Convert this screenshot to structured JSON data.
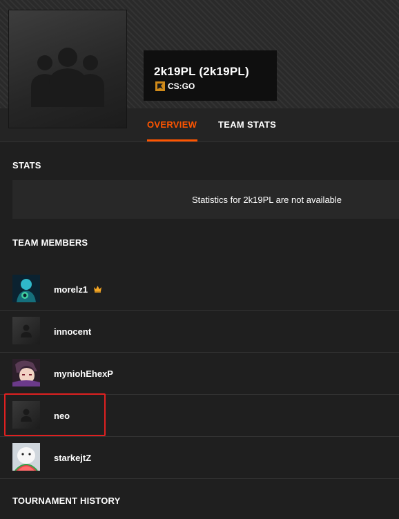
{
  "header": {
    "team_name": "2k19PL (2k19PL)",
    "game": "CS:GO",
    "game_icon": "csgo-icon",
    "team_avatar_icon": "team-placeholder-icon"
  },
  "tabs": [
    {
      "label": "OVERVIEW",
      "active": true
    },
    {
      "label": "TEAM STATS",
      "active": false
    }
  ],
  "accent_color": "#ff5500",
  "sections": {
    "stats_title": "STATS",
    "stats_message": "Statistics for 2k19PL are not available",
    "members_title": "TEAM MEMBERS",
    "history_title": "TOURNAMENT HISTORY"
  },
  "members": [
    {
      "name": "morelz1",
      "is_leader": true,
      "avatar": "photo-teal-character"
    },
    {
      "name": "innocent",
      "is_leader": false,
      "avatar": "default-avatar"
    },
    {
      "name": "myniohEhexP",
      "is_leader": false,
      "avatar": "photo-anime-character"
    },
    {
      "name": "neo",
      "is_leader": false,
      "avatar": "default-avatar"
    },
    {
      "name": "starkejtZ",
      "is_leader": false,
      "avatar": "photo-dog-watermelon"
    }
  ],
  "leader_icon": "crown-icon",
  "highlight_color": "#e02020"
}
